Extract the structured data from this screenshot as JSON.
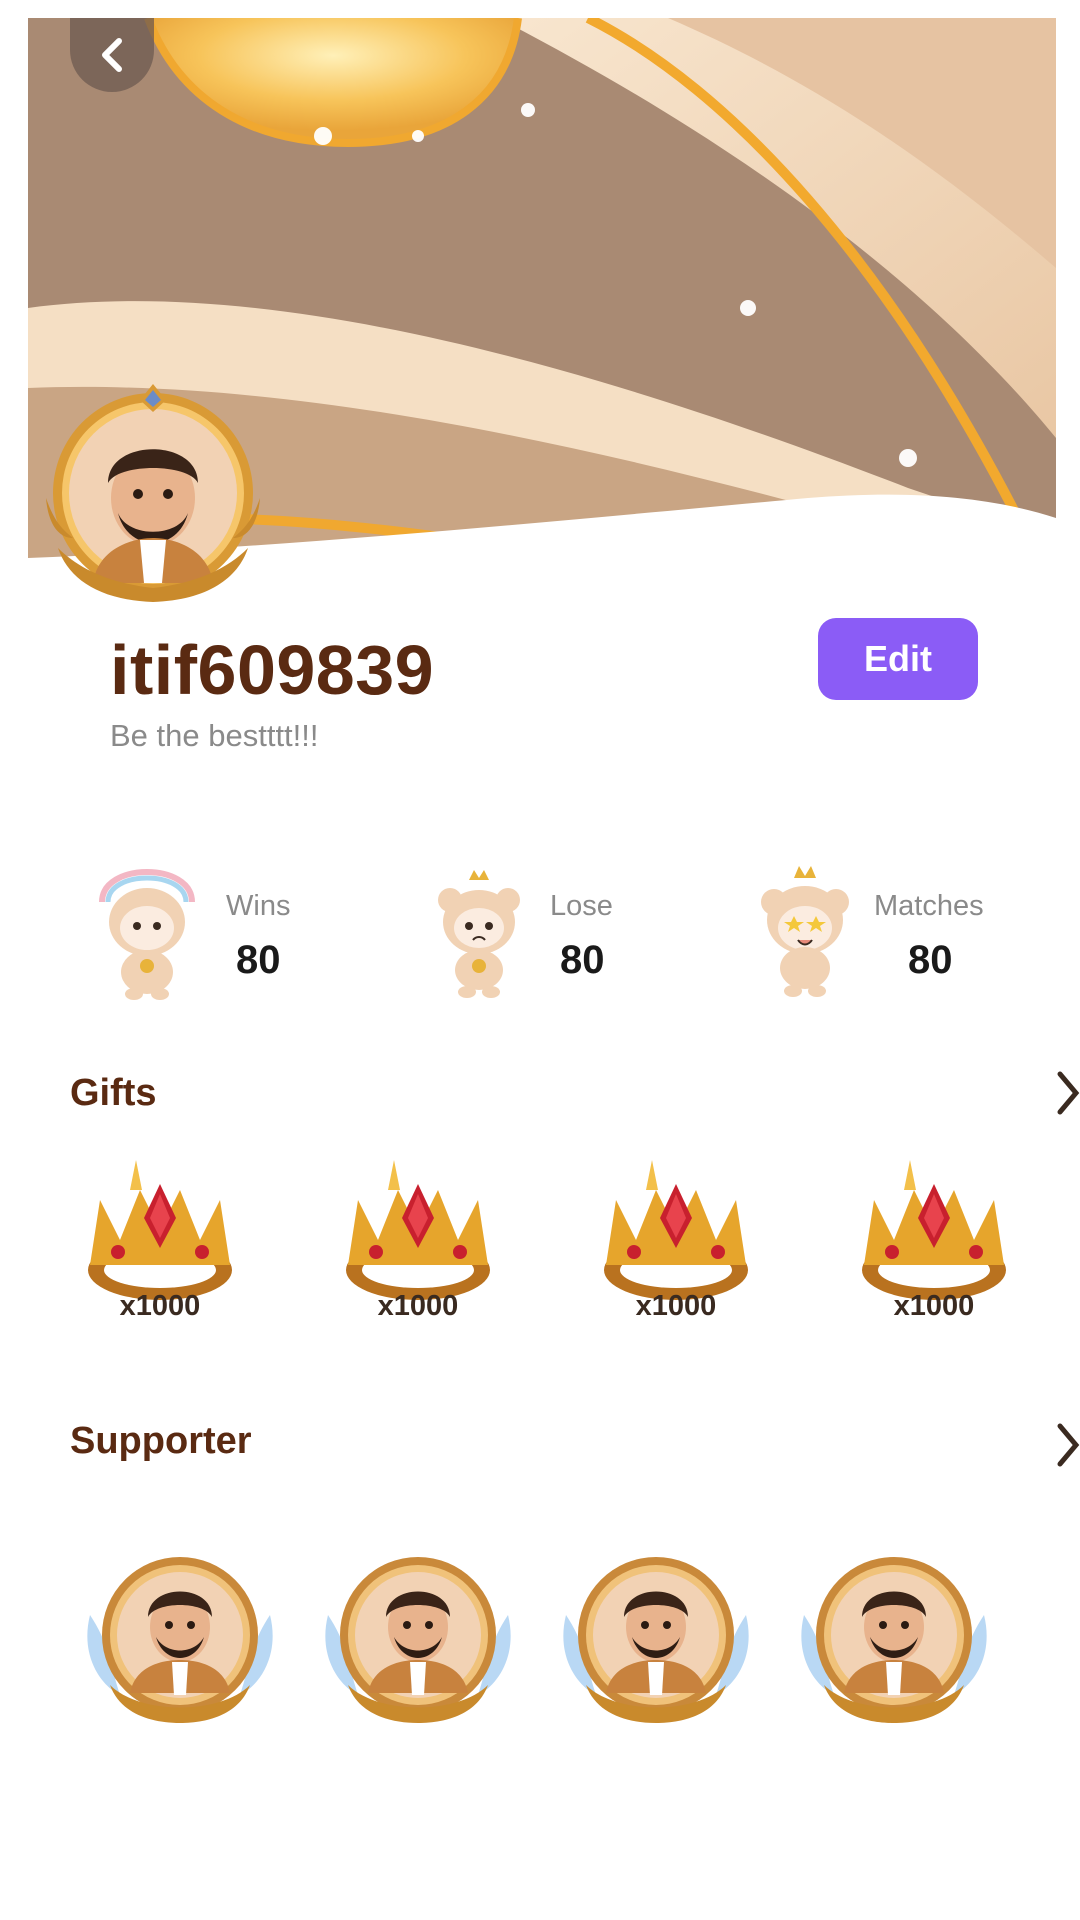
{
  "header": {
    "back_icon": "chevron-left-icon"
  },
  "profile": {
    "username": "itif609839",
    "bio": "Be the bestttt!!!",
    "edit_label": "Edit"
  },
  "stats": [
    {
      "label": "Wins",
      "value": "80"
    },
    {
      "label": "Lose",
      "value": "80"
    },
    {
      "label": "Matches",
      "value": "80"
    }
  ],
  "gifts": {
    "title": "Gifts",
    "items": [
      {
        "qty": "x1000"
      },
      {
        "qty": "x1000"
      },
      {
        "qty": "x1000"
      },
      {
        "qty": "x1000"
      }
    ]
  },
  "supporter": {
    "title": "Supporter",
    "count": 4
  },
  "colors": {
    "accent": "#8b5cf6",
    "title_brown": "#5a2a12",
    "banner_brown": "#a98a73",
    "banner_cream": "#f3dcc0",
    "gold": "#f0b23a"
  }
}
